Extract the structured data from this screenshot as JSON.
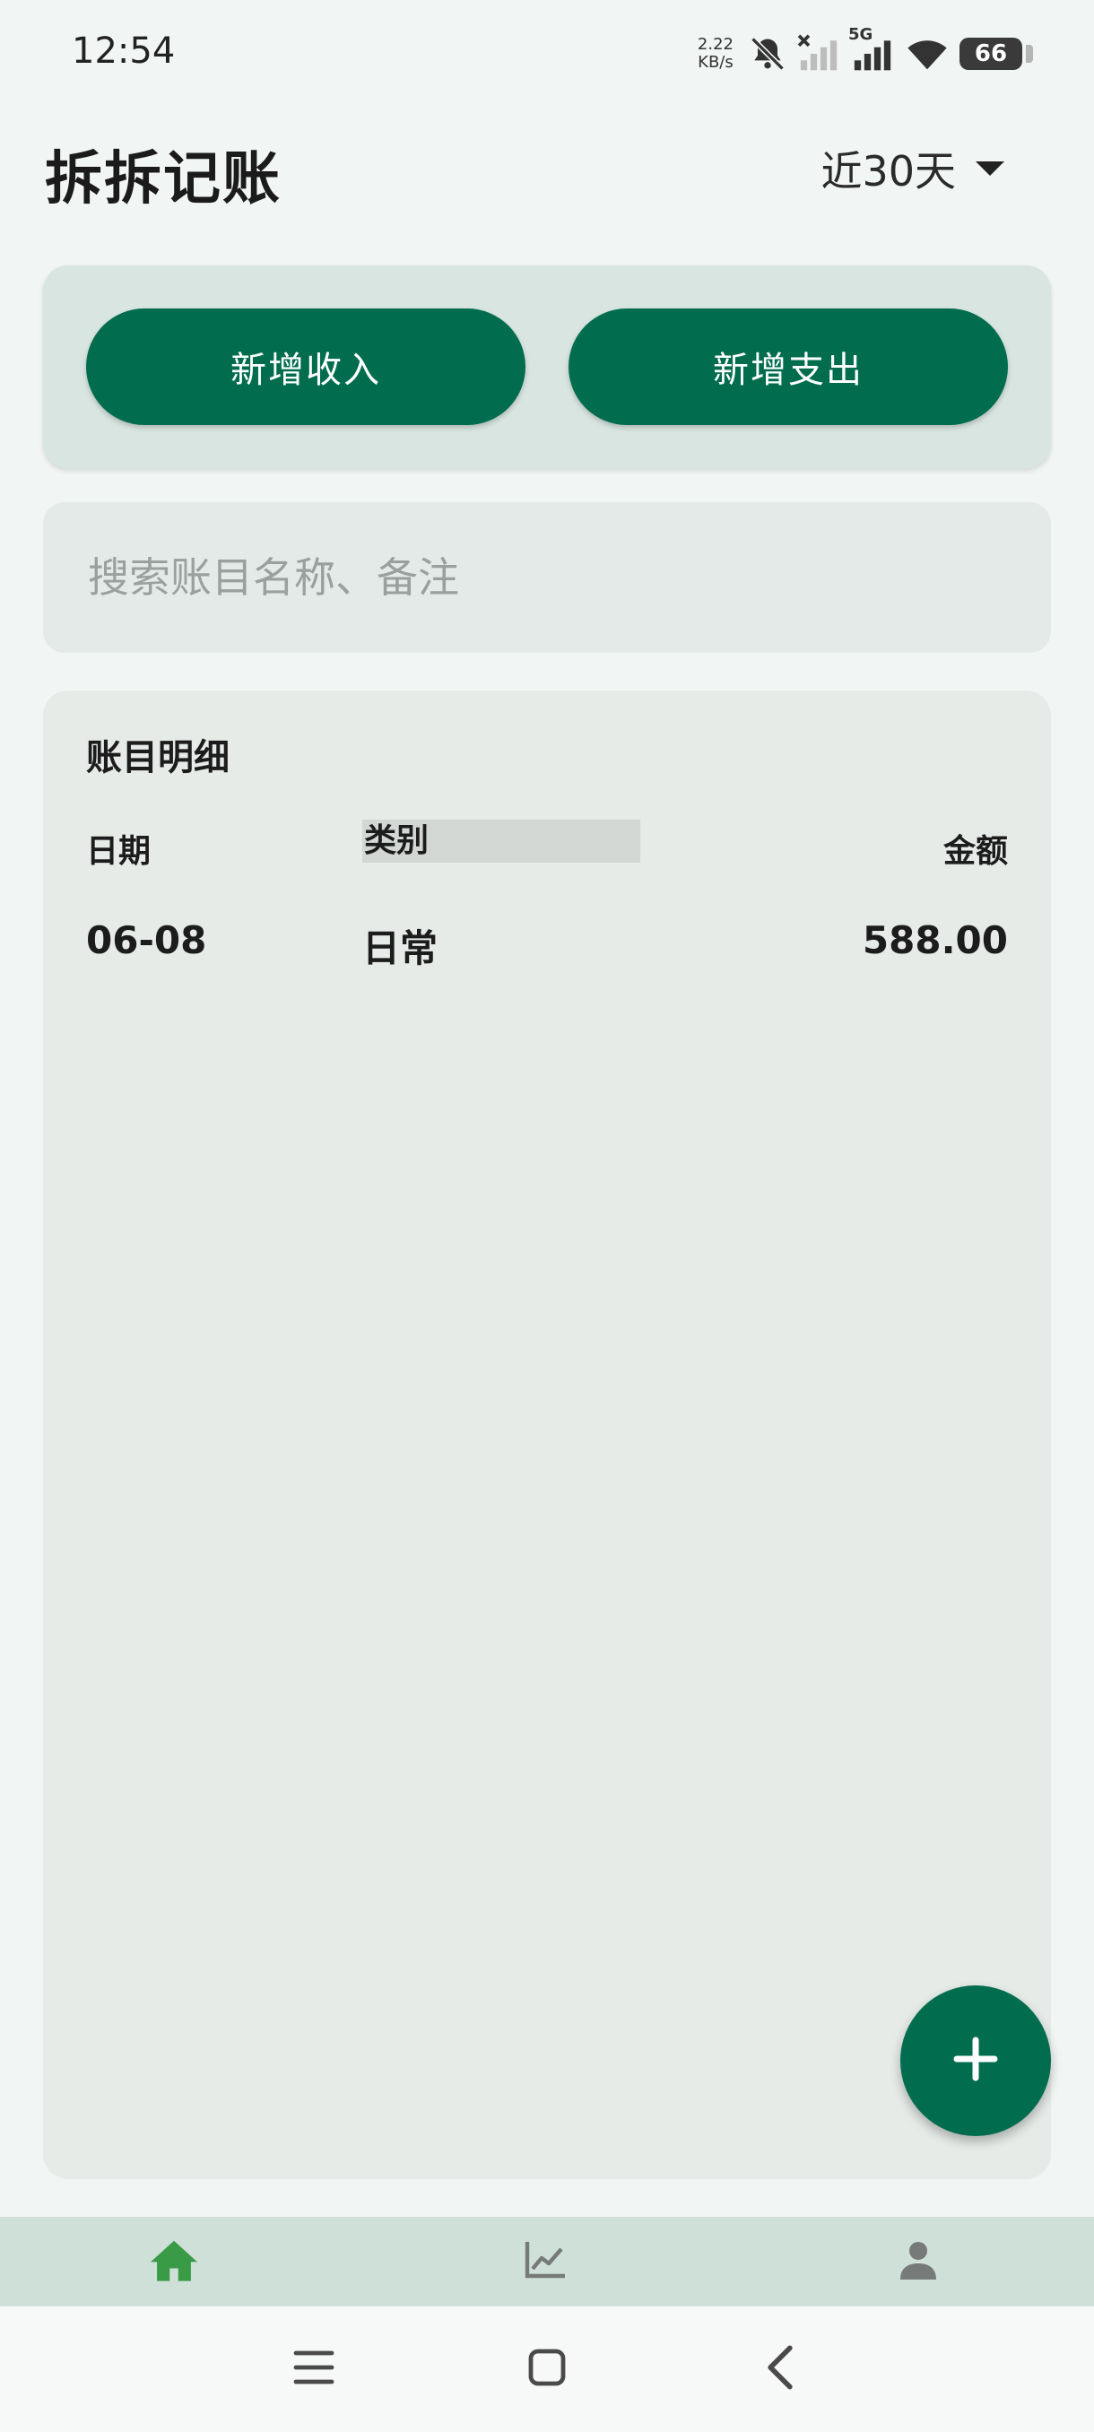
{
  "status_bar": {
    "time": "12:54",
    "net_speed_value": "2.22",
    "net_speed_unit": "KB/s",
    "network_label": "5G",
    "battery": "66",
    "icons": [
      "bell-muted-icon",
      "signal-no-service-icon",
      "signal-5g-icon",
      "wifi-icon",
      "battery-icon"
    ]
  },
  "header": {
    "title": "拆拆记账",
    "period": "近30天"
  },
  "actions": {
    "add_income": "新增收入",
    "add_expense": "新增支出"
  },
  "search": {
    "placeholder": "搜索账目名称、备注",
    "value": ""
  },
  "ledger": {
    "title": "账目明细",
    "columns": {
      "date": "日期",
      "category": "类别",
      "amount": "金额"
    },
    "rows": [
      {
        "date": "06-08",
        "category": "日常",
        "amount": "588.00"
      }
    ]
  },
  "fab": {
    "icon": "plus-icon"
  },
  "bottom_nav": {
    "items": [
      {
        "icon": "home-icon",
        "active": true
      },
      {
        "icon": "chart-icon",
        "active": false
      },
      {
        "icon": "person-icon",
        "active": false
      }
    ]
  },
  "colors": {
    "primary": "#016d4e",
    "nav_active": "#3a9b46",
    "nav_inactive": "#767a78",
    "background": "#f1f5f4"
  }
}
